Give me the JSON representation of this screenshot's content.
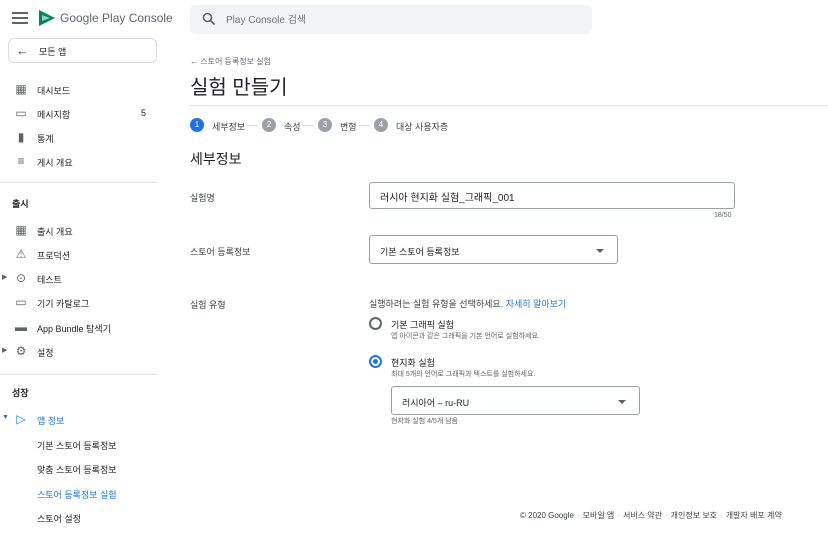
{
  "app": {
    "brand": "Google Play Console",
    "all_apps": "모든 앱"
  },
  "search": {
    "placeholder": "Play Console 검색"
  },
  "sidebar": {
    "main": [
      {
        "label": "대시보드",
        "icon": "dashboard-icon"
      },
      {
        "label": "메시지함",
        "icon": "inbox-icon",
        "badge": "5"
      },
      {
        "label": "통계",
        "icon": "bar-chart-icon"
      },
      {
        "label": "게시 개요",
        "icon": "publishing-icon"
      }
    ],
    "release_title": "출시",
    "release": [
      {
        "label": "출시 개요",
        "icon": "release-overview-icon"
      },
      {
        "label": "프로덕션",
        "icon": "production-icon"
      },
      {
        "label": "테스트",
        "icon": "testing-icon"
      },
      {
        "label": "기기 카탈로그",
        "icon": "devices-icon"
      },
      {
        "label": "App Bundle 탐색기",
        "icon": "bundle-icon"
      },
      {
        "label": "설정",
        "icon": "gear-icon"
      }
    ],
    "growth_title": "성장",
    "growth": [
      {
        "label": "앱 정보",
        "icon": "play-icon"
      }
    ],
    "growth_sub": [
      {
        "label": "기본 스토어 등록정보"
      },
      {
        "label": "맞춤 스토어 등록정보"
      },
      {
        "label": "스토어 등록정보 실험"
      },
      {
        "label": "스토어 설정"
      }
    ]
  },
  "main": {
    "back_link": "스토어 등록정보 실험",
    "title": "실험 만들기",
    "steps": [
      {
        "num": "1",
        "label": "세부정보"
      },
      {
        "num": "2",
        "label": "속성"
      },
      {
        "num": "3",
        "label": "변형"
      },
      {
        "num": "4",
        "label": "대상 사용자층"
      }
    ],
    "section_title": "세부정보",
    "name_label": "실험명",
    "name_value": "러시아 현지화 실험_그래픽_001",
    "name_counter": "18/50",
    "listing_label": "스토어 등록정보",
    "listing_value": "기본 스토어 등록정보",
    "type_label": "실험 유형",
    "type_help": "실행하려는 실험 유형을 선택하세요.",
    "type_help_link": "자세히 알아보기",
    "option_default_title": "기본 그래픽 실험",
    "option_default_desc": "앱 아이콘과 같은 그래픽을 기본 언어로 실험하세요.",
    "option_local_title": "현지화 실험",
    "option_local_desc": "최대 5개의 언어로 그래픽과 텍스트를 실험하세요.",
    "language_value": "러시아어 – ru-RU",
    "remaining": "현지화 실험 4/5개 남음"
  },
  "footer": {
    "copyright": "© 2020 Google",
    "links": [
      "모바일 앱",
      "서비스 약관",
      "개인정보 보호",
      "개발자 배포 계약"
    ]
  },
  "colors": {
    "accent": "#1a73e8",
    "text": "#202124",
    "muted": "#5f6368"
  }
}
